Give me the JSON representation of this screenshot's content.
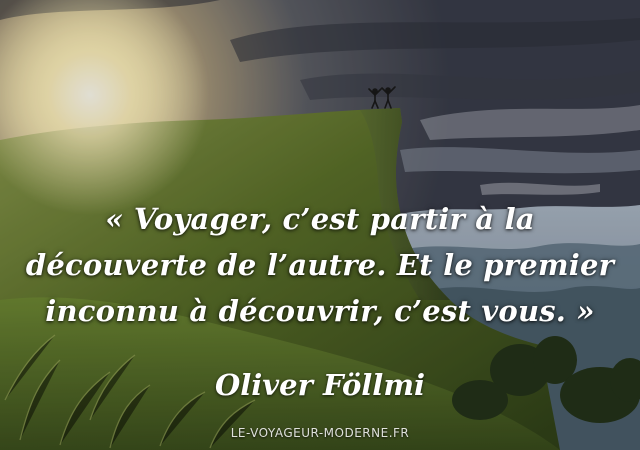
{
  "quote": {
    "line1": "« Voyager, c’est partir à la",
    "line2": "découverte de l’autre. Et le premier",
    "line3": "inconnu à découvrir, c’est vous. »"
  },
  "author": "Oliver Föllmi",
  "website": "LE-VOYAGEUR-MODERNE.FR",
  "colors": {
    "sky_dark": "#3c3f4a",
    "sun_glow": "#fff6c8",
    "grass": "#5f7a2e",
    "mountains": "#7b8fa3",
    "text": "#ffffff"
  }
}
